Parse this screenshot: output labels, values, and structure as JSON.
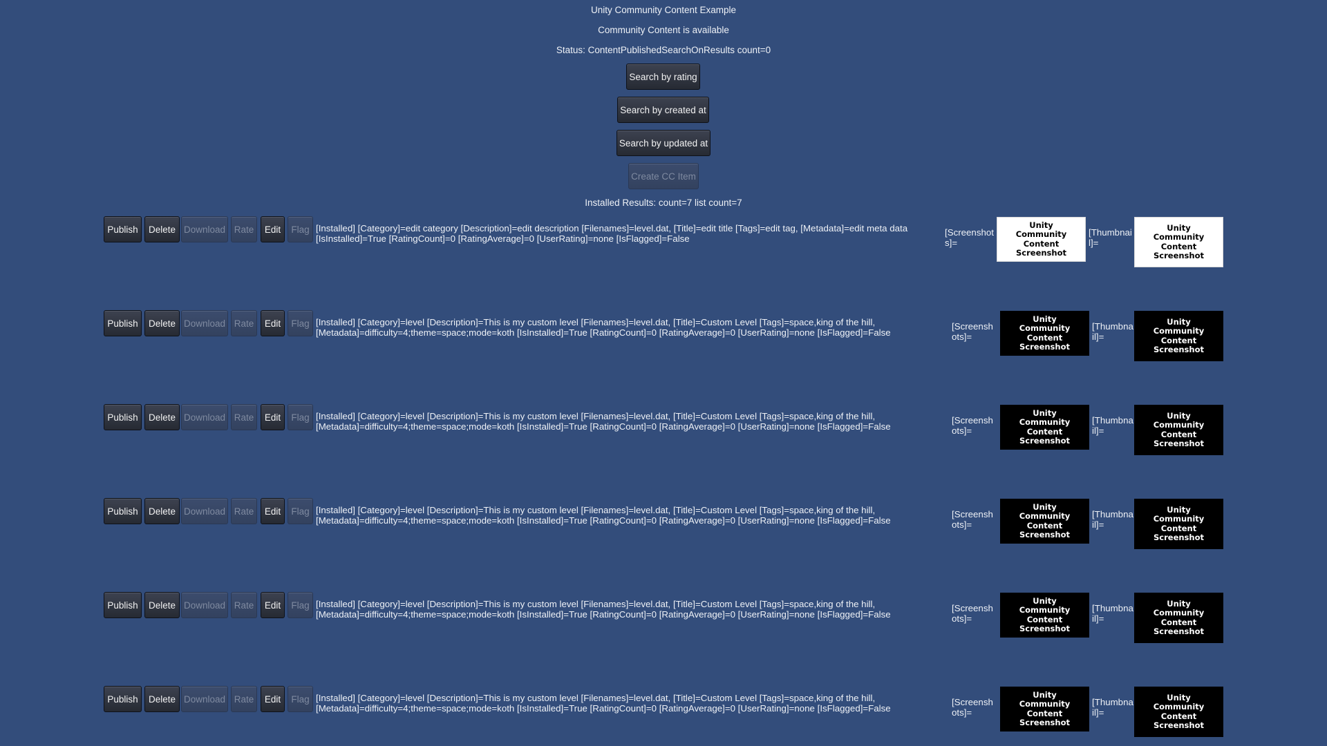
{
  "header": {
    "title": "Unity Community Content Example",
    "availability": "Community Content is available",
    "status": "Status: ContentPublishedSearchOnResults count=0"
  },
  "controls": {
    "search_rating": "Search by rating",
    "search_created": "Search by created at",
    "search_updated": "Search by updated at",
    "create_item": "Create CC Item"
  },
  "results_summary": "Installed Results: count=7 list count=7",
  "row_buttons": {
    "publish": "Publish",
    "delete": "Delete",
    "download": "Download",
    "rate": "Rate",
    "edit": "Edit",
    "flag": "Flag"
  },
  "labels": {
    "screenshots": "[Screenshots]=",
    "thumbnail": "[Thumbnail]="
  },
  "image_text": {
    "line1": "Unity",
    "line2": "Community",
    "line3": "Content",
    "line4": "Screenshot"
  },
  "items": [
    {
      "description": "[Installed] [Category]=edit category [Description]=edit description [Filenames]=level.dat, [Title]=edit title [Tags]=edit tag, [Metadata]=edit meta data [IsInstalled]=True [RatingCount]=0 [RatingAverage]=0 [UserRating]=none [IsFlagged]=False"
    },
    {
      "description": "[Installed] [Category]=level [Description]=This is my custom level [Filenames]=level.dat, [Title]=Custom Level [Tags]=space,king of the hill, [Metadata]=difficulty=4;theme=space;mode=koth [IsInstalled]=True [RatingCount]=0 [RatingAverage]=0 [UserRating]=none [IsFlagged]=False"
    },
    {
      "description": "[Installed] [Category]=level [Description]=This is my custom level [Filenames]=level.dat, [Title]=Custom Level [Tags]=space,king of the hill, [Metadata]=difficulty=4;theme=space;mode=koth [IsInstalled]=True [RatingCount]=0 [RatingAverage]=0 [UserRating]=none [IsFlagged]=False"
    },
    {
      "description": "[Installed] [Category]=level [Description]=This is my custom level [Filenames]=level.dat, [Title]=Custom Level [Tags]=space,king of the hill, [Metadata]=difficulty=4;theme=space;mode=koth [IsInstalled]=True [RatingCount]=0 [RatingAverage]=0 [UserRating]=none [IsFlagged]=False"
    },
    {
      "description": "[Installed] [Category]=level [Description]=This is my custom level [Filenames]=level.dat, [Title]=Custom Level [Tags]=space,king of the hill, [Metadata]=difficulty=4;theme=space;mode=koth [IsInstalled]=True [RatingCount]=0 [RatingAverage]=0 [UserRating]=none [IsFlagged]=False"
    },
    {
      "description": "[Installed] [Category]=level [Description]=This is my custom level [Filenames]=level.dat, [Title]=Custom Level [Tags]=space,king of the hill, [Metadata]=difficulty=4;theme=space;mode=koth [IsInstalled]=True [RatingCount]=0 [RatingAverage]=0 [UserRating]=none [IsFlagged]=False"
    }
  ]
}
